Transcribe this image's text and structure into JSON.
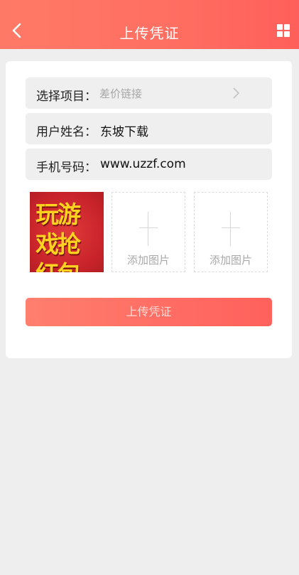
{
  "header": {
    "title": "上传凭证",
    "back_icon": "chevron-left-icon",
    "menu_icon": "grid-icon",
    "gradient": [
      "#ff7a66",
      "#ff5f5a"
    ]
  },
  "form": {
    "project": {
      "label": "选择项目：",
      "placeholder": "差价链接"
    },
    "username": {
      "label": "用户姓名：",
      "value": "东坡下载"
    },
    "phone": {
      "label": "手机号码：",
      "value": "www.uzzf.com"
    }
  },
  "images": {
    "uploaded_text": "玩游戏抢红包",
    "add_label_1": "添加图片",
    "add_label_2": "添加图片"
  },
  "submit_label": "上传凭证"
}
